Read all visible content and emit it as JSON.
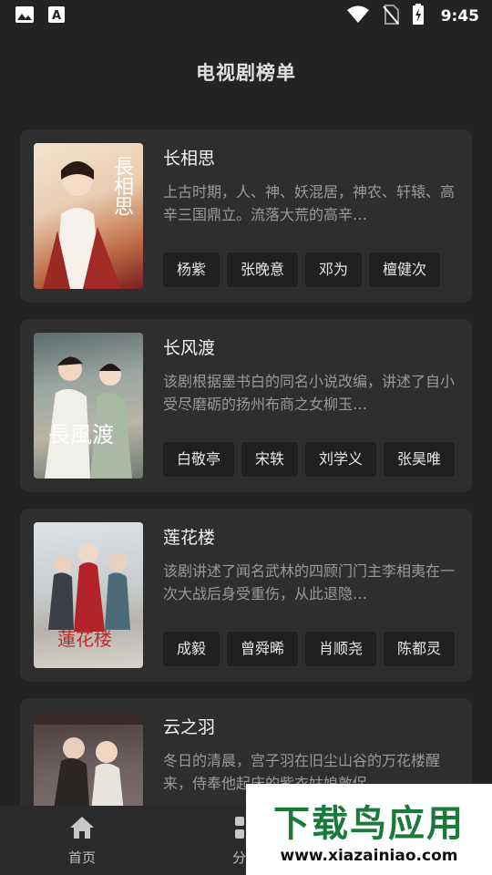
{
  "status_bar": {
    "time": "9:45",
    "icons": [
      "image-icon",
      "text-a-icon",
      "wifi-icon",
      "no-sim-icon",
      "battery-charging-icon"
    ]
  },
  "app_bar": {
    "title": "电视剧榜单"
  },
  "dramas": [
    {
      "name": "长相思",
      "desc": "上古时期，人、神、妖混居，神农、轩辕、高辛三国鼎立。流落大荒的高辛…",
      "poster_text": "長相思",
      "cast": [
        "杨紫",
        "张晚意",
        "邓为",
        "檀健次"
      ]
    },
    {
      "name": "长风渡",
      "desc": "该剧根据墨书白的同名小说改编，讲述了自小受尽磨砺的扬州布商之女柳玉…",
      "poster_text": "長風渡",
      "cast": [
        "白敬亭",
        "宋轶",
        "刘学义",
        "张昊唯"
      ]
    },
    {
      "name": "莲花楼",
      "desc": "该剧讲述了闻名武林的四顾门门主李相夷在一次大战后身受重伤，从此退隐…",
      "poster_text": "蓮花楼",
      "cast": [
        "成毅",
        "曾舜晞",
        "肖顺尧",
        "陈都灵"
      ]
    },
    {
      "name": "云之羽",
      "desc": "冬日的清晨，宫子羽在旧尘山谷的万花楼醒来，侍奉他起床的紫衣姑娘敦促…",
      "poster_text": "",
      "cast": []
    }
  ],
  "tab_bar": {
    "tabs": [
      {
        "label": "首页",
        "icon": "home-icon"
      },
      {
        "label": "分类",
        "icon": "grid-icon"
      }
    ]
  },
  "watermark": {
    "main": "下载鸟应用",
    "url": "www.xiazainiao.com"
  },
  "colors": {
    "background": "#232323",
    "card": "#2e2e2e",
    "tag": "#202020",
    "watermark_green": "#1a7a3a"
  }
}
